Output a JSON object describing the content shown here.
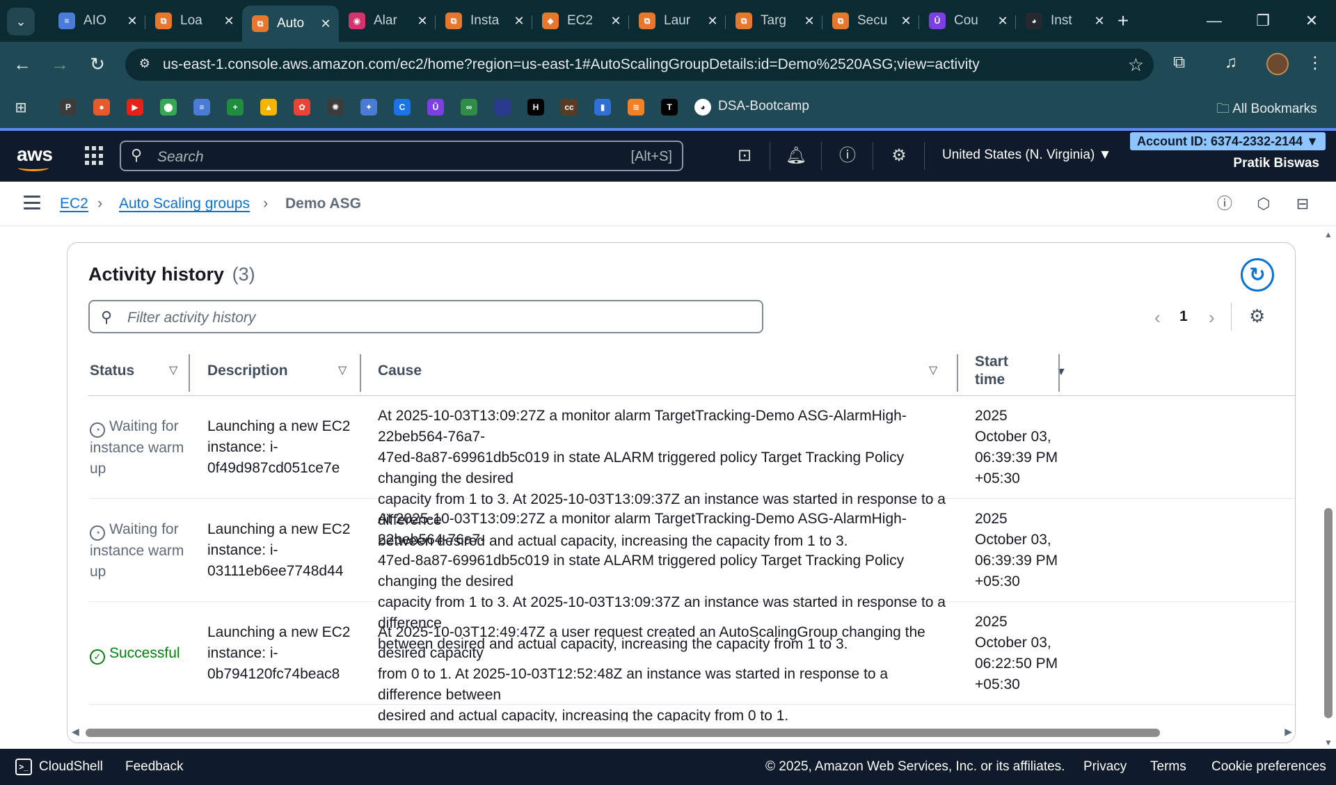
{
  "browser": {
    "tabs": [
      {
        "title": "AIO",
        "color": "#4a7bd6",
        "glyph": "≡"
      },
      {
        "title": "Loa",
        "color": "#e8772e",
        "glyph": "⧉"
      },
      {
        "title": "Auto",
        "color": "#e8772e",
        "glyph": "⧉",
        "active": true
      },
      {
        "title": "Alar",
        "color": "#d6336c",
        "glyph": "◉"
      },
      {
        "title": "Insta",
        "color": "#e8772e",
        "glyph": "⧉"
      },
      {
        "title": "EC2",
        "color": "#e8772e",
        "glyph": "◆"
      },
      {
        "title": "Laur",
        "color": "#e8772e",
        "glyph": "⧉"
      },
      {
        "title": "Targ",
        "color": "#e8772e",
        "glyph": "⧉"
      },
      {
        "title": "Secu",
        "color": "#e8772e",
        "glyph": "⧉"
      },
      {
        "title": "Cou",
        "color": "#7b3fe4",
        "glyph": "Û"
      },
      {
        "title": "Inst",
        "color": "#24292f",
        "glyph": "◕"
      }
    ],
    "url": "us-east-1.console.aws.amazon.com/ec2/home?region=us-east-1#AutoScalingGroupDetails:id=Demo%2520ASG;view=activity",
    "bookmark_label": "DSA-Bootcamp",
    "all_bookmarks": "All Bookmarks",
    "bookmark_icons": [
      {
        "name": "p-icon",
        "color": "#3c3c3c",
        "glyph": "P"
      },
      {
        "name": "firefox-icon",
        "color": "#e8592e",
        "glyph": "●"
      },
      {
        "name": "youtube-icon",
        "color": "#e62117",
        "glyph": "▶"
      },
      {
        "name": "maps-icon",
        "color": "#34a853",
        "glyph": "⬤"
      },
      {
        "name": "docs-icon",
        "color": "#4a7bd6",
        "glyph": "≡"
      },
      {
        "name": "sheets-icon",
        "color": "#1e8e3e",
        "glyph": "+"
      },
      {
        "name": "drive-icon",
        "color": "#f4b400",
        "glyph": "▲"
      },
      {
        "name": "photos-icon",
        "color": "#ea4335",
        "glyph": "✿"
      },
      {
        "name": "chatgpt-icon",
        "color": "#3c3c3c",
        "glyph": "✺"
      },
      {
        "name": "gemini-icon",
        "color": "#4a7bd6",
        "glyph": "✦"
      },
      {
        "name": "c-icon",
        "color": "#1a73e8",
        "glyph": "C"
      },
      {
        "name": "u-icon",
        "color": "#7b3fe4",
        "glyph": "Û"
      },
      {
        "name": "gfg-icon",
        "color": "#2f8d46",
        "glyph": "∞"
      },
      {
        "name": "square-icon",
        "color": "#2a3b8f",
        "glyph": " "
      },
      {
        "name": "hi-icon",
        "color": "#000000",
        "glyph": "H"
      },
      {
        "name": "cc-icon",
        "color": "#5a3a22",
        "glyph": "cc"
      },
      {
        "name": "bars-icon",
        "color": "#2f6fd6",
        "glyph": "▮"
      },
      {
        "name": "stack-icon",
        "color": "#f48024",
        "glyph": "≋"
      },
      {
        "name": "tuf-icon",
        "color": "#000000",
        "glyph": "T"
      }
    ]
  },
  "aws": {
    "search_placeholder": "Search",
    "search_shortcut": "[Alt+S]",
    "region": "United States (N. Virginia) ▼",
    "account": "Account ID: 6374-2332-2144 ▼",
    "user": "Pratik Biswas"
  },
  "breadcrumb": {
    "items": [
      "EC2",
      "Auto Scaling groups"
    ],
    "current": "Demo ASG"
  },
  "panel": {
    "title": "Activity history",
    "count": "(3)",
    "filter_placeholder": "Filter activity history",
    "page": "1"
  },
  "table": {
    "headers": {
      "status": "Status",
      "description": "Description",
      "cause": "Cause",
      "start_time_1": "Start",
      "start_time_2": "time"
    },
    "rows": [
      {
        "status": [
          "Waiting for",
          "instance warm",
          "up"
        ],
        "status_type": "waiting",
        "description": [
          "Launching a new EC2",
          "instance: i-",
          "0f49d987cd051ce7e"
        ],
        "cause": [
          "At 2025-10-03T13:09:27Z a monitor alarm TargetTracking-Demo ASG-AlarmHigh-22beb564-76a7-",
          "47ed-8a87-69961db5c019 in state ALARM triggered policy Target Tracking Policy changing the desired",
          "capacity from 1 to 3. At 2025-10-03T13:09:37Z an instance was started in response to a difference",
          "between desired and actual capacity, increasing the capacity from 1 to 3."
        ],
        "start_time": [
          "2025",
          "October 03,",
          "06:39:39 PM",
          "+05:30"
        ]
      },
      {
        "status": [
          "Waiting for",
          "instance warm",
          "up"
        ],
        "status_type": "waiting",
        "description": [
          "Launching a new EC2",
          "instance: i-",
          "03111eb6ee7748d44"
        ],
        "cause": [
          "At 2025-10-03T13:09:27Z a monitor alarm TargetTracking-Demo ASG-AlarmHigh-22beb564-76a7-",
          "47ed-8a87-69961db5c019 in state ALARM triggered policy Target Tracking Policy changing the desired",
          "capacity from 1 to 3. At 2025-10-03T13:09:37Z an instance was started in response to a difference",
          "between desired and actual capacity, increasing the capacity from 1 to 3."
        ],
        "start_time": [
          "2025",
          "October 03,",
          "06:39:39 PM",
          "+05:30"
        ]
      },
      {
        "status": [
          "Successful"
        ],
        "status_type": "success",
        "description": [
          "Launching a new EC2",
          "instance: i-",
          "0b794120fc74beac8"
        ],
        "cause": [
          "At 2025-10-03T12:49:47Z a user request created an AutoScalingGroup changing the desired capacity",
          "from 0 to 1. At 2025-10-03T12:52:48Z an instance was started in response to a difference between",
          "desired and actual capacity, increasing the capacity from 0 to 1."
        ],
        "start_time": [
          "2025",
          "October 03,",
          "06:22:50 PM",
          "+05:30"
        ]
      }
    ]
  },
  "footer": {
    "cloudshell": "CloudShell",
    "feedback": "Feedback",
    "copyright": "© 2025, Amazon Web Services, Inc. or its affiliates.",
    "privacy": "Privacy",
    "terms": "Terms",
    "cookies": "Cookie preferences"
  },
  "colors": {
    "link": "#0972d3",
    "success": "#037f0c",
    "waiting": "#5f6b7a",
    "aws_header": "#0f1b2a",
    "browser_frame": "#0b2b33"
  }
}
